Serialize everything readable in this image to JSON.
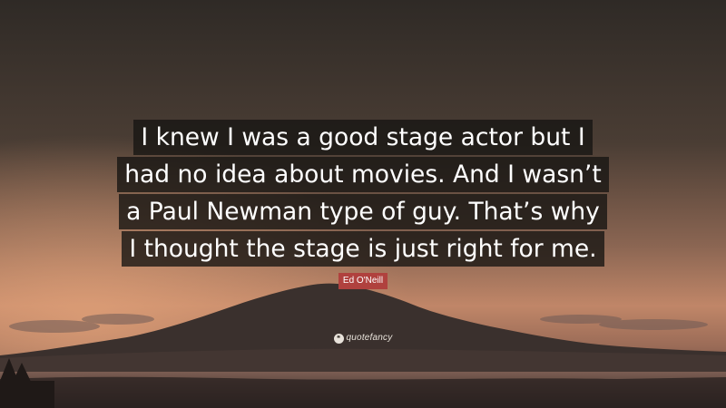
{
  "quote": {
    "lines": [
      "I knew I was a good stage actor but I",
      "had no idea about movies. And I wasn’t",
      "a Paul Newman type of guy. That’s why",
      "I thought the stage is just right for me."
    ]
  },
  "author": "Ed O'Neill",
  "brand": {
    "logo_glyph": "❝",
    "name": "quotefancy"
  },
  "colors": {
    "author_badge": "#b0413e",
    "quote_text": "#ffffff",
    "quote_background": "#161412"
  }
}
